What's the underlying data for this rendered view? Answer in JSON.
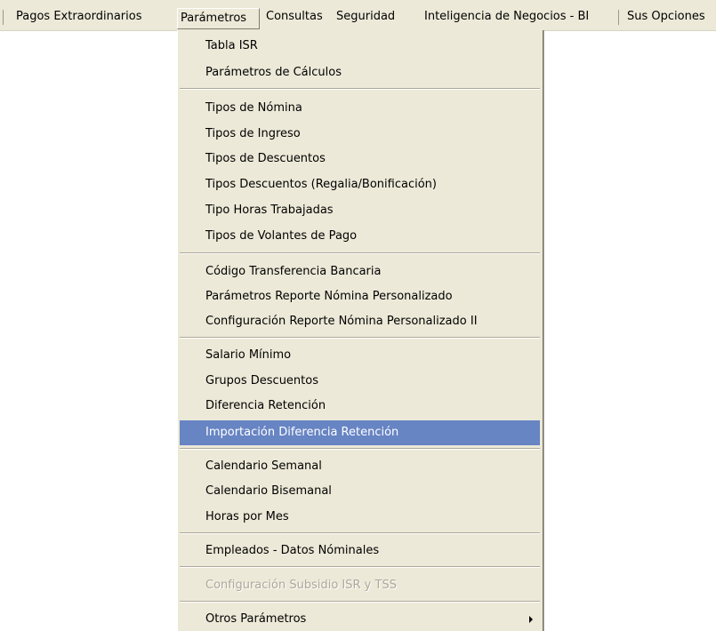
{
  "menubar": {
    "items": [
      {
        "label": "Pagos Extraordinarios"
      },
      {
        "label": "Parámetros",
        "active": true
      },
      {
        "label": "Consultas"
      },
      {
        "label": "Seguridad"
      },
      {
        "label": "Inteligencia de Negocios - BI"
      },
      {
        "label": "Sus Opciones"
      }
    ]
  },
  "dropdown": {
    "groups": [
      [
        "Tabla  ISR",
        "Parámetros de Cálculos"
      ],
      [
        "Tipos de Nómina",
        "Tipos de Ingreso",
        "Tipos de Descuentos",
        "Tipos Descuentos (Regalia/Bonificación)",
        "Tipo Horas Trabajadas",
        "Tipos de Volantes de Pago"
      ],
      [
        "Código Transferencia Bancaria",
        "Parámetros Reporte Nómina Personalizado",
        "Configuración Reporte Nómina Personalizado II"
      ],
      [
        "Salario Mínimo",
        "Grupos Descuentos",
        "Diferencia Retención",
        "Importación Diferencia Retención"
      ],
      [
        "Calendario Semanal",
        "Calendario Bisemanal",
        "Horas por Mes"
      ],
      [
        "Empleados - Datos Nóminales"
      ],
      [
        "Configuración Subsidio ISR y TSS"
      ],
      [
        "Otros Parámetros"
      ]
    ],
    "highlighted_item": "Importación Diferencia Retención",
    "disabled_item": "Configuración Subsidio ISR y TSS",
    "submenu_item": "Otros Parámetros",
    "submenu_arrow_icon": "triangle-right-icon"
  },
  "colors": {
    "menu_background": "#ece9d8",
    "highlight": "#6784c3",
    "disabled_text": "#aca899"
  }
}
